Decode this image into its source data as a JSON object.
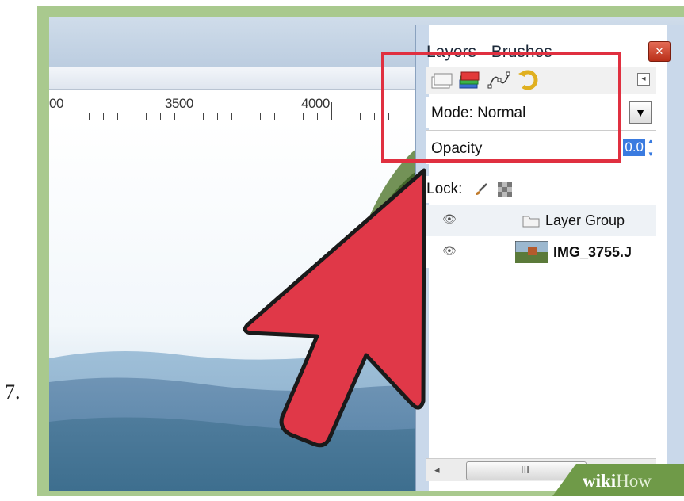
{
  "step_number": "7.",
  "ruler": {
    "labels": [
      "00",
      "3500",
      "4000"
    ]
  },
  "panel": {
    "title": "Layers - Brushes",
    "close_icon": "close-icon",
    "tabs": [
      "layers-tab-icon",
      "channels-tab-icon",
      "paths-tab-icon",
      "undo-history-tab-icon"
    ],
    "mode_label": "Mode: Normal",
    "opacity_label": "Opacity",
    "opacity_value": "0.0",
    "lock_label": "Lock:",
    "layers": [
      {
        "name": "Layer Group",
        "icon": "folder-icon"
      },
      {
        "name": "IMG_3755.J",
        "icon": "image-thumbnail"
      }
    ]
  },
  "scrollbar": {
    "grip": "III"
  },
  "watermark": {
    "part1": "wiki",
    "part2": "How"
  },
  "colors": {
    "highlight": "#e03040",
    "arrow_fill": "#e03848",
    "frame": "#a9c98e",
    "selection": "#3a7be0"
  }
}
